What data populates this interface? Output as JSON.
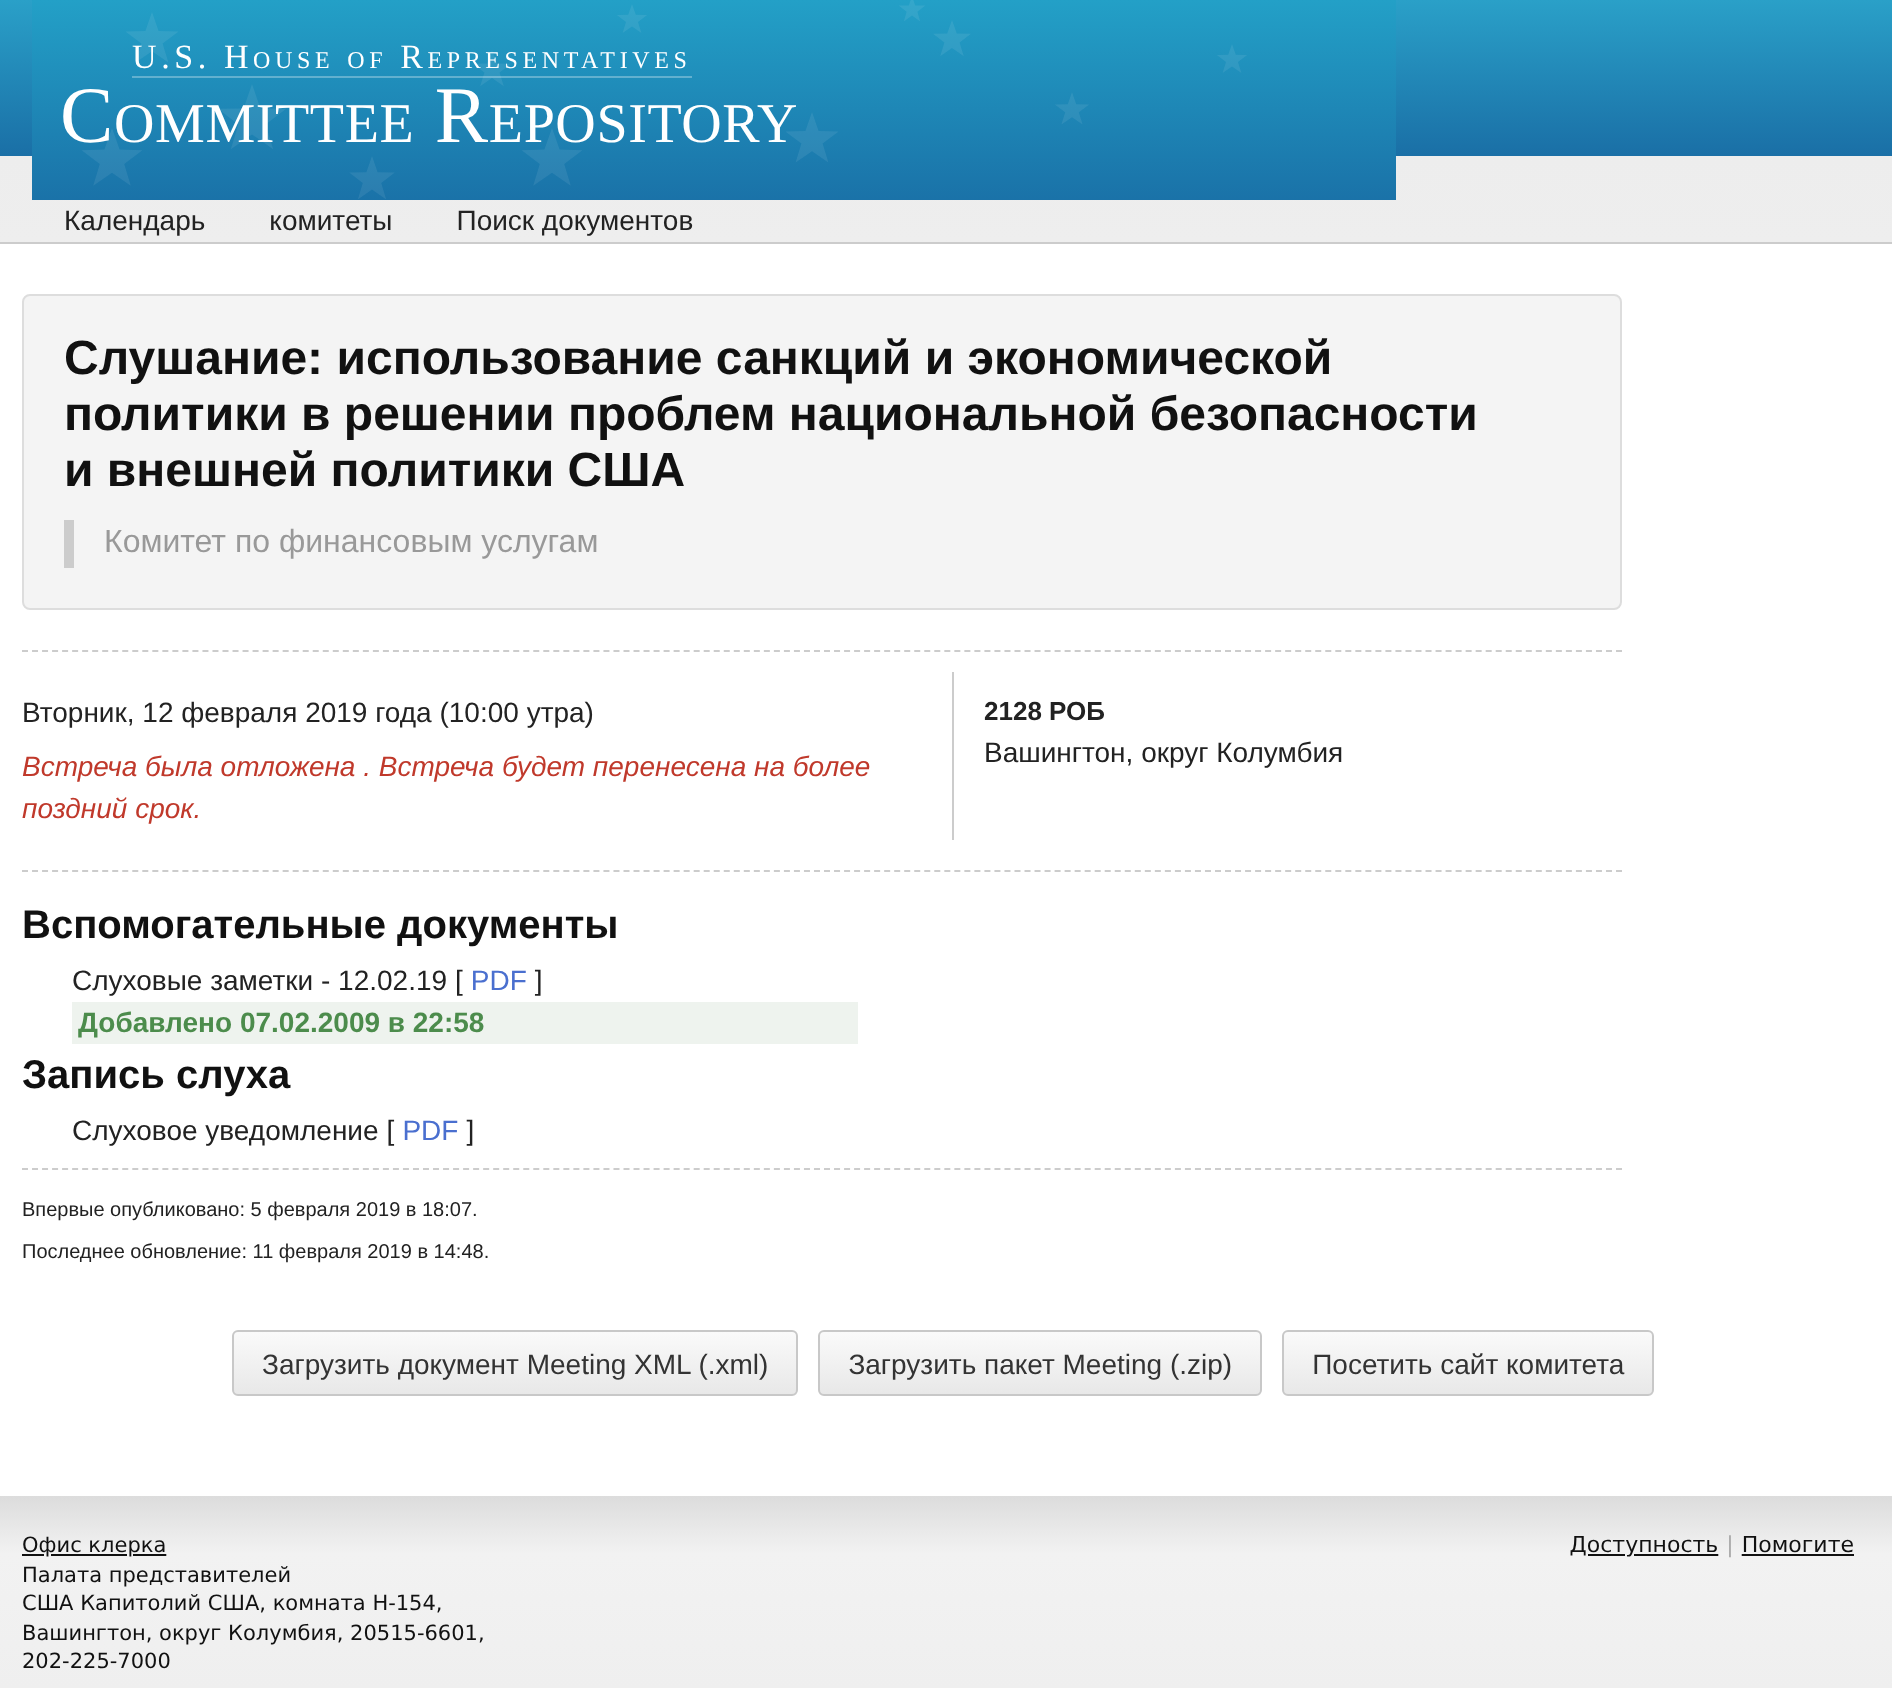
{
  "header": {
    "subtitle": "U.S. House of Representatives",
    "title": "Committee Repository"
  },
  "nav": [
    {
      "label": "Календарь"
    },
    {
      "label": "комитеты"
    },
    {
      "label": "Поиск документов"
    }
  ],
  "hearing": {
    "title": "Слушание: использование санкций и экономической политики в решении проблем национальной безопасности и внешней политики США",
    "committee": "Комитет по финансовым услугам"
  },
  "schedule": {
    "date": "Вторник, 12 февраля 2019 года (10:00 утра)",
    "notice": "Встреча была отложена . Встреча будет перенесена на более поздний срок.",
    "room": "2128 РОБ",
    "city": "Вашингтон, округ Колумбия"
  },
  "sections": [
    {
      "heading": "Вспомогательные документы",
      "documents": [
        {
          "name": "Слуховые заметки - 12.02.19",
          "open_bracket": "[",
          "link": "PDF",
          "close_bracket": "]",
          "added": "Добавлено 07.02.2009 в 22:58"
        }
      ]
    },
    {
      "heading": "Запись слуха",
      "documents": [
        {
          "name": "Слуховое уведомление",
          "open_bracket": "[",
          "link": "PDF",
          "close_bracket": "]"
        }
      ]
    }
  ],
  "published": "Впервые опубликовано: 5 февраля 2019 в 18:07.",
  "updated": "Последнее обновление: 11 февраля 2019 в 14:48.",
  "buttons": [
    "Загрузить документ Meeting XML (.xml)",
    "Загрузить пакет Meeting (.zip)",
    "Посетить сайт комитета"
  ],
  "footer": {
    "office_link": "Офис клерка",
    "address": [
      "Палата представителей",
      "США Капитолий США, комната H-154,",
      "Вашингтон, округ Колумбия, 20515-6601,",
      "202-225-7000"
    ],
    "links": [
      "Доступность",
      "Помогите"
    ],
    "separator": "|"
  }
}
